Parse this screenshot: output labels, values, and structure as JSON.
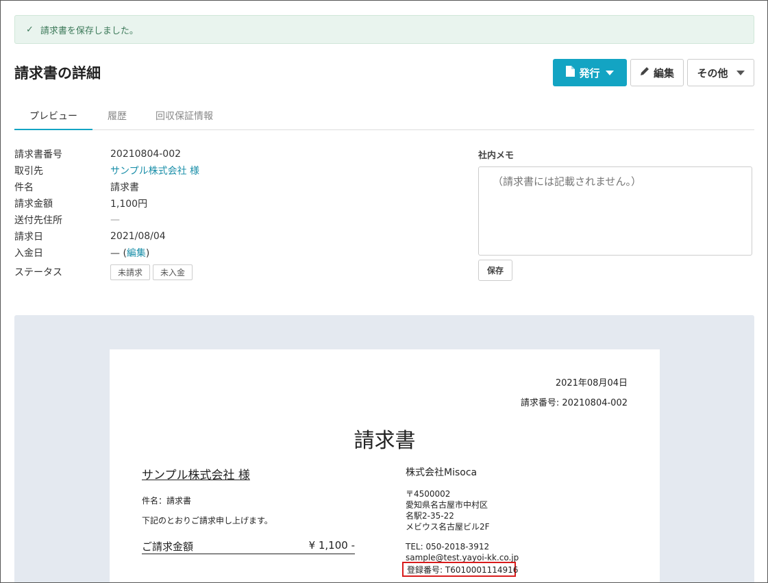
{
  "alert": {
    "message": "請求書を保存しました。"
  },
  "header": {
    "title": "請求書の詳細",
    "issue_label": "発行",
    "edit_label": "編集",
    "other_label": "その他"
  },
  "tabs": [
    {
      "label": "プレビュー"
    },
    {
      "label": "履歴"
    },
    {
      "label": "回収保証情報"
    }
  ],
  "details": [
    {
      "key": "請求書番号",
      "value": "20210804-002"
    },
    {
      "key": "取引先",
      "value": "サンプル株式会社 様"
    },
    {
      "key": "件名",
      "value": "請求書"
    },
    {
      "key": "請求金額",
      "value": "1,100円"
    },
    {
      "key": "送付先住所",
      "value": "—"
    },
    {
      "key": "請求日",
      "value": "2021/08/04"
    },
    {
      "key": "入金日",
      "value": "— (",
      "link": "編集",
      "suffix": ")"
    },
    {
      "key": "ステータス",
      "tags": [
        "未請求",
        "未入金"
      ]
    }
  ],
  "memo": {
    "label": "社内メモ",
    "placeholder": "（請求書には記載されません。）",
    "save_label": "保存"
  },
  "invoice": {
    "date": "2021年08月04日",
    "number": "請求番号: 20210804-002",
    "title": "請求書",
    "client": "サンプル株式会社 様",
    "subject": "件名：請求書",
    "lead": "下記のとおりご請求申し上げます。",
    "amount_label": "ご請求金額",
    "amount_value": "¥ 1,100 -",
    "company": "株式会社Misoca",
    "postal": "〒4500002",
    "address1": "愛知県名古屋市中村区",
    "address2": "名駅2-35-22",
    "address3": "メビウス名古屋ビル2F",
    "tel": "TEL: 050-2018-3912",
    "email": "sample@test.yayoi-kk.co.jp",
    "registration": "登録番号: T6010001114916"
  }
}
